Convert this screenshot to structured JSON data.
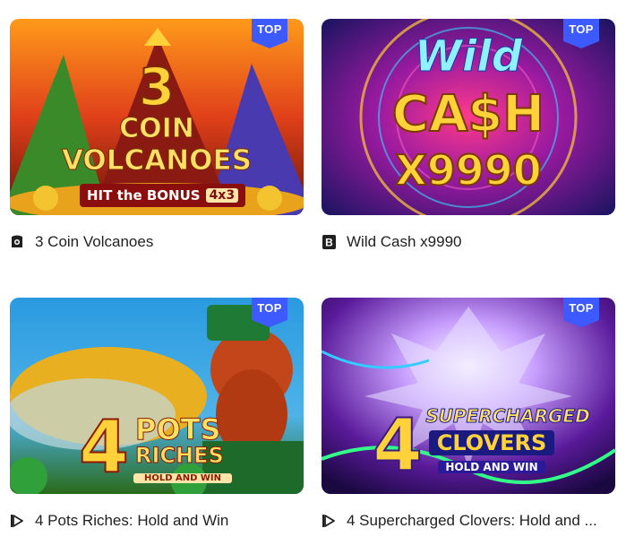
{
  "games": [
    {
      "title": "3 Coin Volcanoes",
      "badge": "TOP",
      "provider_icon": "provider-logo-icon",
      "art": {
        "line1": "3",
        "line2": "COIN",
        "line3": "VOLCANOES",
        "line4": "HIT the BONUS",
        "line5": "4x3"
      }
    },
    {
      "title": "Wild Cash x9990",
      "badge": "TOP",
      "provider_icon": "provider-b-icon",
      "art": {
        "line1": "Wild",
        "line2": "CA$H",
        "line3": "X9990"
      }
    },
    {
      "title": "4 Pots Riches: Hold and Win",
      "badge": "TOP",
      "provider_icon": "provider-play-icon",
      "art": {
        "line1": "4",
        "line2": "POTS",
        "line3": "RICHES",
        "line4": "HOLD AND WIN"
      }
    },
    {
      "title": "4 Supercharged Clovers: Hold and ...",
      "badge": "TOP",
      "provider_icon": "provider-play-icon",
      "art": {
        "line1": "4",
        "line2": "SUPERCHARGED",
        "line3": "CLOVERS",
        "line4": "HOLD AND WIN"
      }
    }
  ],
  "colors": {
    "badge": "#3d5afe",
    "title_text": "#1f1f1f"
  }
}
